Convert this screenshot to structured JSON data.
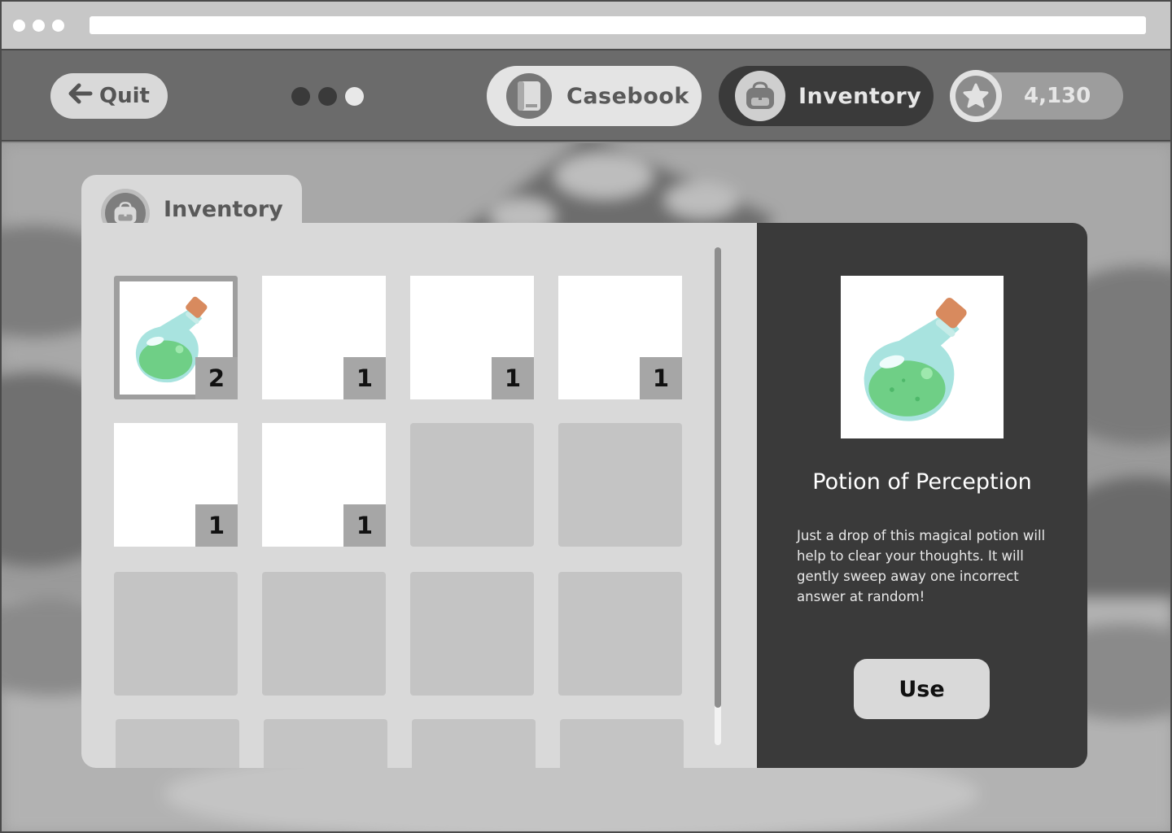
{
  "topbar": {
    "quit_label": "Quit",
    "casebook_label": "Casebook",
    "inventory_label": "Inventory",
    "coins": "4,130",
    "pager": {
      "count": 3,
      "active_index": 2
    }
  },
  "panel": {
    "tab_title": "Inventory",
    "slots": [
      {
        "item": "potion",
        "count": "2",
        "selected": true
      },
      {
        "item": "blank",
        "count": "1"
      },
      {
        "item": "blank",
        "count": "1"
      },
      {
        "item": "blank",
        "count": "1"
      },
      {
        "item": "blank",
        "count": "1"
      },
      {
        "item": "blank",
        "count": "1"
      },
      {
        "item": null
      },
      {
        "item": null
      },
      {
        "item": null
      },
      {
        "item": null
      },
      {
        "item": null
      },
      {
        "item": null
      },
      {
        "item": null
      },
      {
        "item": null
      },
      {
        "item": null
      },
      {
        "item": null
      }
    ]
  },
  "detail": {
    "title": "Potion of Perception",
    "description": "Just a drop of this magical potion will help to clear your thoughts. It will gently sweep away one incorrect answer at random!",
    "use_label": "Use"
  },
  "colors": {
    "potion_liquid": "#6fcf86",
    "potion_glass": "#a8e3df",
    "potion_cork": "#d88a5e",
    "active_tab": "#3a3a3a"
  }
}
